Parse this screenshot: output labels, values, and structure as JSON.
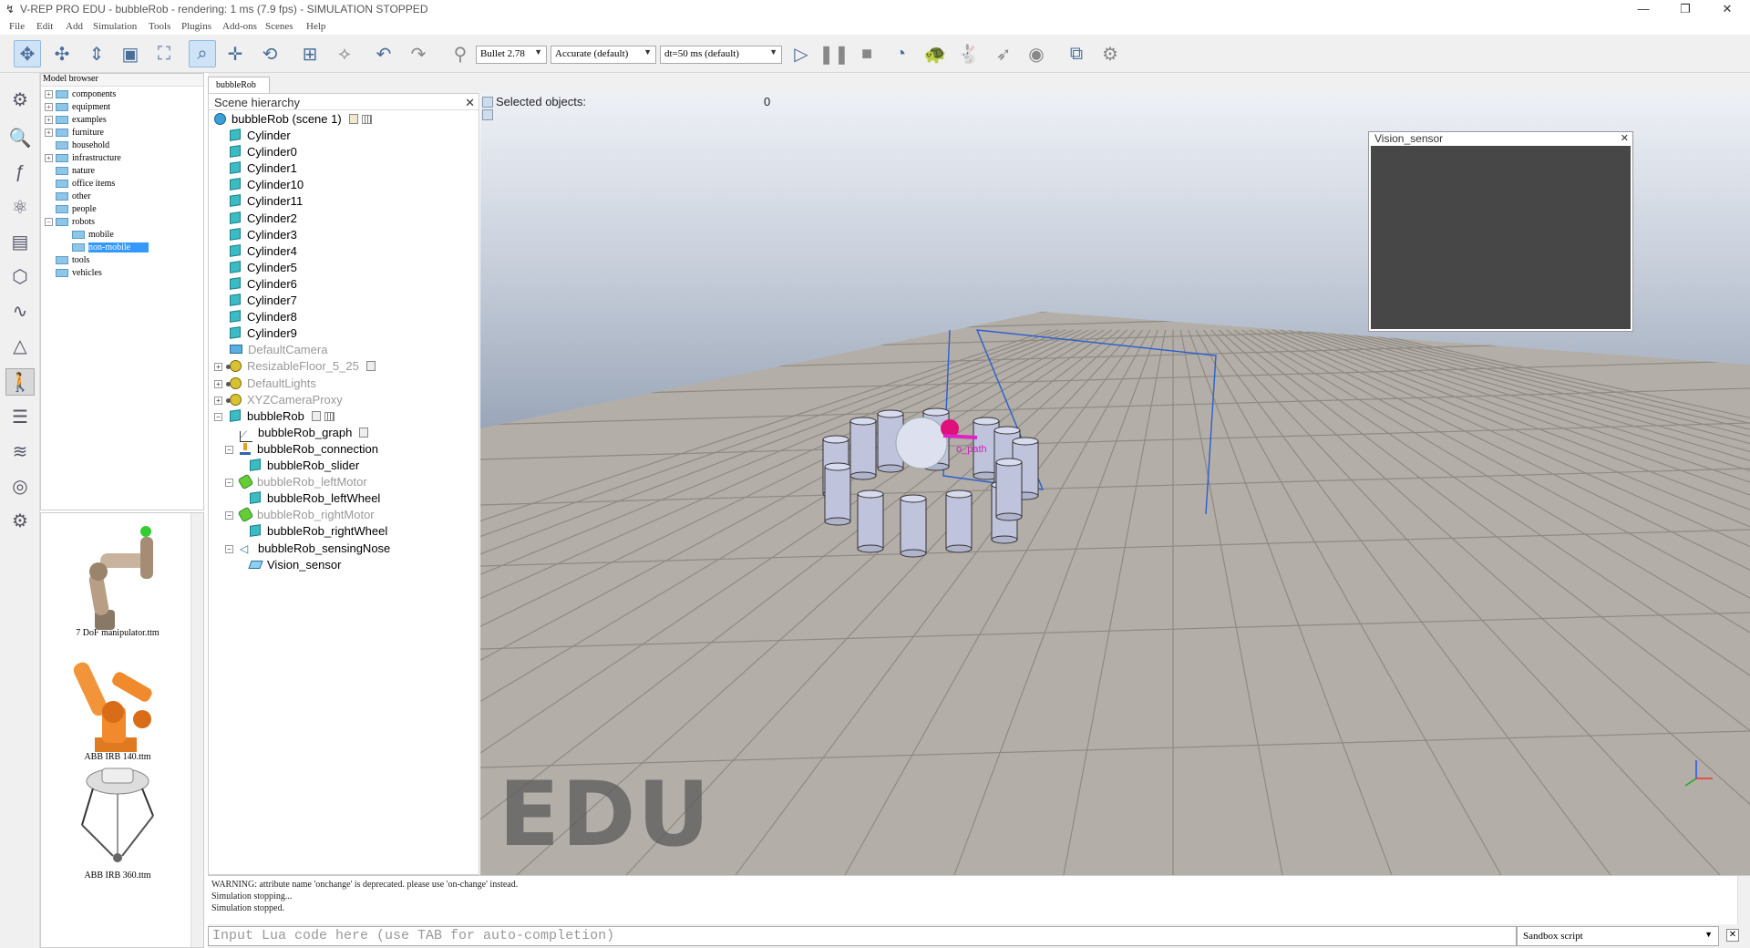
{
  "window": {
    "title": "V-REP PRO EDU - bubbleRob - rendering: 1 ms (7.9 fps) - SIMULATION STOPPED",
    "minimize": "—",
    "restore": "❐",
    "close": "✕"
  },
  "menu": [
    "File",
    "Edit",
    "Add",
    "Simulation",
    "Tools",
    "Plugins",
    "Add-ons",
    "Scenes",
    "Help"
  ],
  "toolbar": {
    "engine": "Bullet 2.78",
    "accuracy": "Accurate (default)",
    "timestep": "dt=50 ms (default)"
  },
  "model_browser": {
    "header": "Model browser",
    "items": [
      {
        "label": "components",
        "expandable": true
      },
      {
        "label": "equipment",
        "expandable": true
      },
      {
        "label": "examples",
        "expandable": true
      },
      {
        "label": "furniture",
        "expandable": true
      },
      {
        "label": "household",
        "expandable": false
      },
      {
        "label": "infrastructure",
        "expandable": true
      },
      {
        "label": "nature",
        "expandable": false
      },
      {
        "label": "office items",
        "expandable": false
      },
      {
        "label": "other",
        "expandable": false
      },
      {
        "label": "people",
        "expandable": false
      },
      {
        "label": "robots",
        "expandable": true,
        "expanded": true
      },
      {
        "label": "mobile",
        "expandable": false,
        "child": true
      },
      {
        "label": "non-mobile",
        "expandable": false,
        "child": true,
        "selected": true
      },
      {
        "label": "tools",
        "expandable": false
      },
      {
        "label": "vehicles",
        "expandable": false
      }
    ]
  },
  "thumbnails": [
    "7 DoF manipulator.ttm",
    "ABB IRB 140.ttm",
    "ABB IRB 360.ttm"
  ],
  "scene_tab": "bubbleRob",
  "hierarchy": {
    "header": "Scene hierarchy",
    "root": "bubbleRob (scene 1)",
    "items": [
      {
        "label": "Cylinder",
        "icon": "cube"
      },
      {
        "label": "Cylinder0",
        "icon": "cube"
      },
      {
        "label": "Cylinder1",
        "icon": "cube"
      },
      {
        "label": "Cylinder10",
        "icon": "cube"
      },
      {
        "label": "Cylinder11",
        "icon": "cube"
      },
      {
        "label": "Cylinder2",
        "icon": "cube"
      },
      {
        "label": "Cylinder3",
        "icon": "cube"
      },
      {
        "label": "Cylinder4",
        "icon": "cube"
      },
      {
        "label": "Cylinder5",
        "icon": "cube"
      },
      {
        "label": "Cylinder6",
        "icon": "cube"
      },
      {
        "label": "Cylinder7",
        "icon": "cube"
      },
      {
        "label": "Cylinder8",
        "icon": "cube"
      },
      {
        "label": "Cylinder9",
        "icon": "cube"
      },
      {
        "label": "DefaultCamera",
        "icon": "camera",
        "grey": true
      },
      {
        "label": "ResizableFloor_5_25",
        "icon": "light",
        "grey": true,
        "expandable": true
      },
      {
        "label": "DefaultLights",
        "icon": "light",
        "grey": true,
        "expandable": true
      },
      {
        "label": "XYZCameraProxy",
        "icon": "light",
        "grey": true,
        "expandable": true
      },
      {
        "label": "bubbleRob",
        "icon": "cube",
        "expandable": true
      },
      {
        "label": "bubbleRob_graph",
        "icon": "graph",
        "level": 1
      },
      {
        "label": "bubbleRob_connection",
        "icon": "connection",
        "level": 1
      },
      {
        "label": "bubbleRob_slider",
        "icon": "cube",
        "level": 2
      },
      {
        "label": "bubbleRob_leftMotor",
        "icon": "motor",
        "level": 1,
        "grey": true
      },
      {
        "label": "bubbleRob_leftWheel",
        "icon": "cube",
        "level": 2
      },
      {
        "label": "bubbleRob_rightMotor",
        "icon": "motor",
        "level": 1,
        "grey": true
      },
      {
        "label": "bubbleRob_rightWheel",
        "icon": "cube",
        "level": 2
      },
      {
        "label": "bubbleRob_sensingNose",
        "icon": "sensor",
        "level": 1
      },
      {
        "label": "Vision_sensor",
        "icon": "vision",
        "level": 2
      }
    ]
  },
  "viewport": {
    "selected_label": "Selected objects:",
    "selected_count": "0",
    "vision_window_title": "Vision_sensor",
    "watermark": "EDU",
    "path_label": "o_path"
  },
  "console": {
    "lines": [
      "WARNING: attribute name 'onchange' is deprecated. please use 'on-change' instead.",
      "Simulation stopping...",
      "Simulation stopped."
    ],
    "input_placeholder": "Input Lua code here (use TAB for auto-completion)",
    "script_select": "Sandbox script"
  }
}
